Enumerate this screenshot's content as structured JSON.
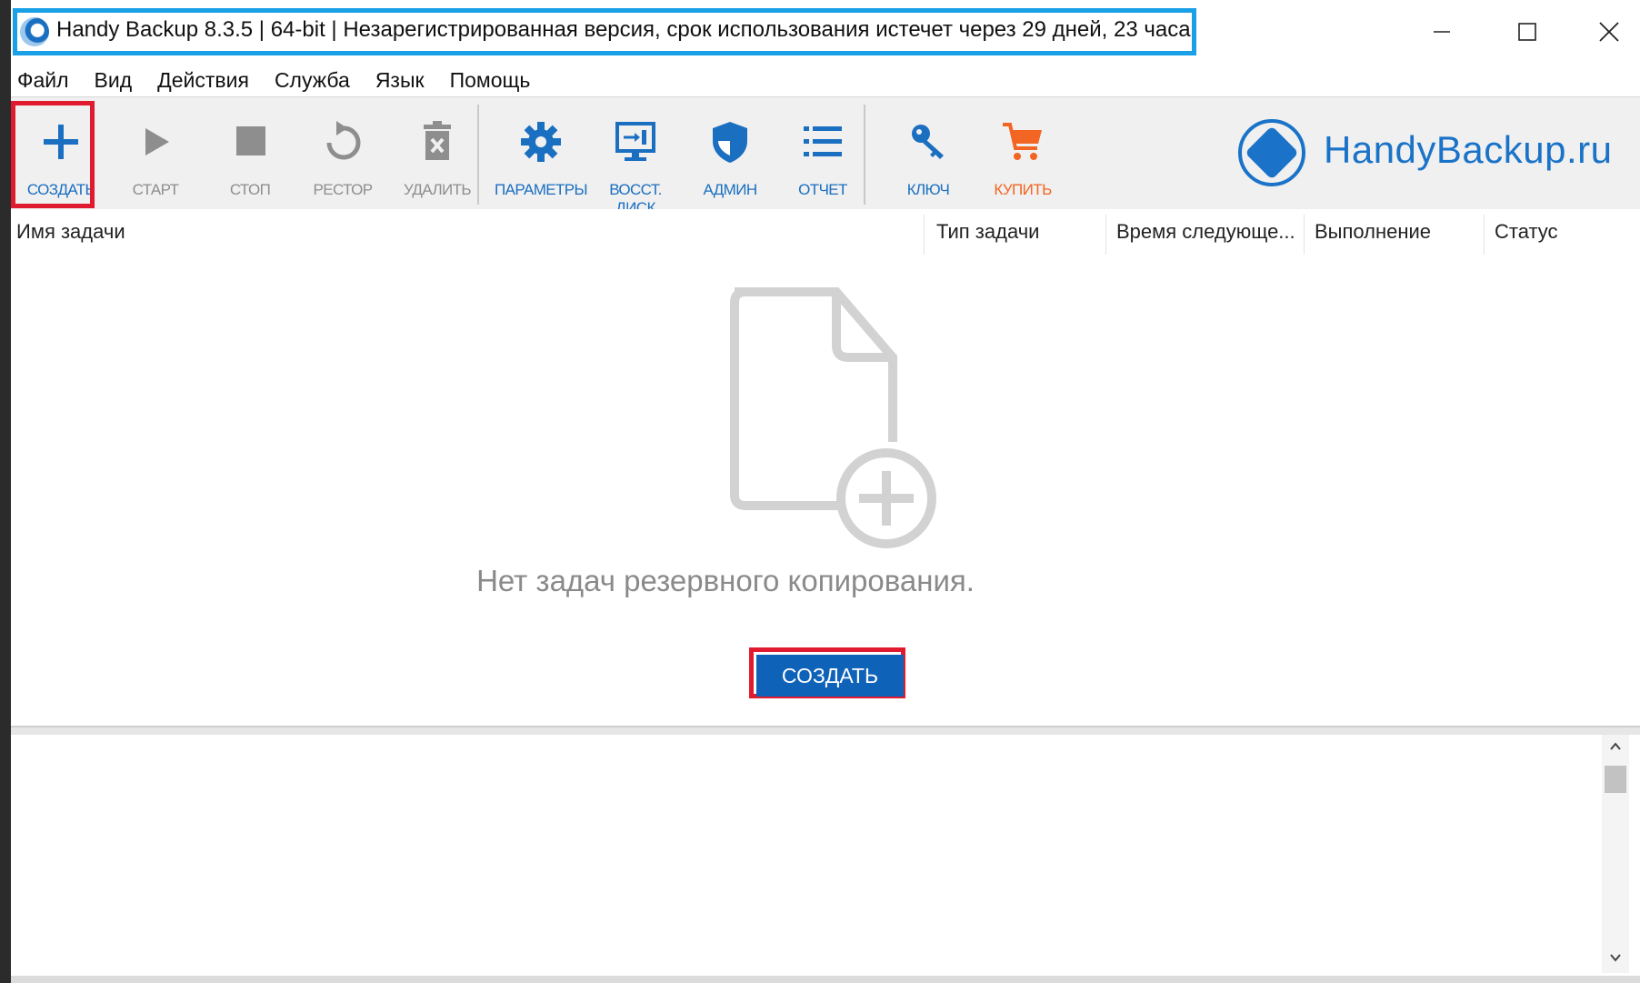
{
  "window": {
    "title": "Handy Backup 8.3.5 | 64-bit | Незарегистрированная версия, срок использования истечет через  29 дней, 23 часа",
    "controls": {
      "minimize": "—",
      "maximize": "☐",
      "close": "✕"
    }
  },
  "menu": {
    "items": [
      "Файл",
      "Вид",
      "Действия",
      "Служба",
      "Язык",
      "Помощь"
    ]
  },
  "toolbar": {
    "buttons": [
      {
        "label": "СОЗДАТЬ",
        "icon": "plus-icon",
        "color": "#1a6fc1"
      },
      {
        "label": "СТАРТ",
        "icon": "play-icon",
        "color": "#8e8e8e"
      },
      {
        "label": "СТОП",
        "icon": "stop-icon",
        "color": "#8e8e8e"
      },
      {
        "label": "РЕСТОР",
        "icon": "restore-icon",
        "color": "#8e8e8e"
      },
      {
        "label": "УДАЛИТЬ",
        "icon": "trash-icon",
        "color": "#8e8e8e"
      },
      {
        "label": "ПАРАМЕТРЫ",
        "icon": "gear-icon",
        "color": "#1a6fc1"
      },
      {
        "label": "ВОССТ. ДИСК",
        "icon": "monitor-restore-icon",
        "color": "#1a6fc1"
      },
      {
        "label": "АДМИН",
        "icon": "shield-icon",
        "color": "#1a6fc1"
      },
      {
        "label": "ОТЧЕТ",
        "icon": "list-icon",
        "color": "#1a6fc1"
      },
      {
        "label": "КЛЮЧ",
        "icon": "key-icon",
        "color": "#1a6fc1"
      },
      {
        "label": "КУПИТЬ",
        "icon": "cart-icon",
        "color": "#f26522"
      }
    ],
    "logo_text": "HandyBackup.ru"
  },
  "table": {
    "columns": [
      "Имя задачи",
      "Тип задачи",
      "Время следующе...",
      "Выполнение",
      "Статус"
    ]
  },
  "main": {
    "empty_message": "Нет задач резервного копирования.",
    "create_button": "СОЗДАТЬ"
  },
  "log_panel": {
    "scroll_up": "^",
    "scroll_down": "v"
  },
  "colors": {
    "accent": "#1a6fc1",
    "highlight_red": "#e01a2f",
    "title_highlight": "#1aa0e6",
    "buy": "#f26522"
  }
}
